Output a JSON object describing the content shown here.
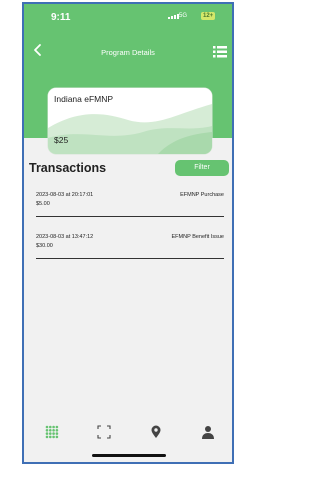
{
  "status_bar": {
    "time": "9:11",
    "network": "5G",
    "battery": "12+"
  },
  "header": {
    "title": "Program Details",
    "back_icon": "chevron-left-icon",
    "menu_icon": "list-icon"
  },
  "card": {
    "program_name": "Indiana eFMNP",
    "balance": "$25"
  },
  "transactions": {
    "heading": "Transactions",
    "filter_label": "Filter",
    "items": [
      {
        "datetime": "2023-08-03 at 20:17:01",
        "type": "EFMNP Purchase",
        "amount": "$5.00"
      },
      {
        "datetime": "2023-08-03 at 13:47:12",
        "type": "EFMNP Benefit Issue",
        "amount": "$30.00"
      }
    ]
  },
  "tab_bar": {
    "tabs": [
      {
        "icon": "grid-dots-icon",
        "active": true
      },
      {
        "icon": "scan-icon",
        "active": false
      },
      {
        "icon": "map-pin-icon",
        "active": false
      },
      {
        "icon": "user-icon",
        "active": false
      }
    ]
  },
  "colors": {
    "accent": "#66c371",
    "background": "#f1f1f1",
    "card_wave_light": "#d6ecd6",
    "card_wave_dark": "#a9d9ac",
    "frame": "#3f6fb5"
  }
}
